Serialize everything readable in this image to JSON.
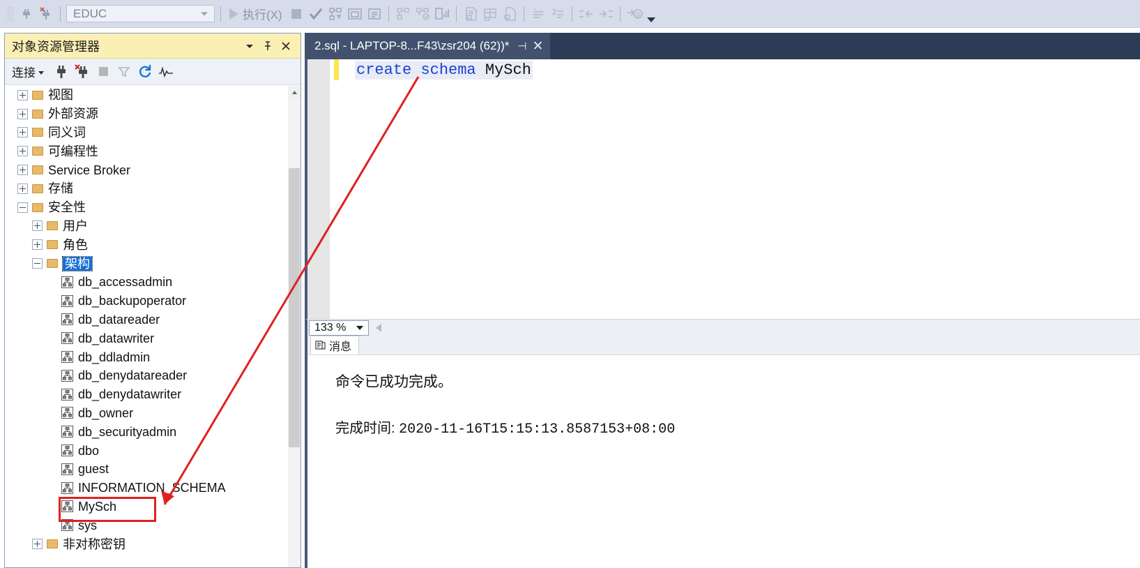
{
  "toolbar": {
    "database_combo": {
      "value": "EDUC",
      "name": "database-selector"
    },
    "execute_label": "执行(X)",
    "icons": [
      "connect-icon",
      "disconnect-icon",
      "stop-icon",
      "parse-check-icon",
      "display-estimated-plan-icon",
      "query-options-icon",
      "include-actual-plan-icon",
      "include-client-statistics-icon",
      "results-to-text-icon",
      "results-to-grid-icon",
      "results-to-file-icon",
      "comment-icon",
      "uncomment-icon",
      "decrease-indent-icon",
      "increase-indent-icon",
      "specify-values-icon"
    ]
  },
  "object_explorer": {
    "title": "对象资源管理器",
    "title_buttons": [
      "window-position-icon",
      "pin-icon",
      "close-icon"
    ],
    "connect_label": "连接",
    "toolbar_icons": [
      "connect-plug-icon",
      "disconnect-plug-icon",
      "stop-icon",
      "filter-icon",
      "refresh-icon",
      "activity-monitor-icon"
    ],
    "tree": [
      {
        "label": "视图",
        "indent": 0,
        "expander": "plus",
        "icon": "folder",
        "selected": false
      },
      {
        "label": "外部资源",
        "indent": 0,
        "expander": "plus",
        "icon": "folder",
        "selected": false
      },
      {
        "label": "同义词",
        "indent": 0,
        "expander": "plus",
        "icon": "folder",
        "selected": false
      },
      {
        "label": "可编程性",
        "indent": 0,
        "expander": "plus",
        "icon": "folder",
        "selected": false
      },
      {
        "label": "Service Broker",
        "indent": 0,
        "expander": "plus",
        "icon": "folder",
        "selected": false
      },
      {
        "label": "存储",
        "indent": 0,
        "expander": "plus",
        "icon": "folder",
        "selected": false
      },
      {
        "label": "安全性",
        "indent": 0,
        "expander": "minus",
        "icon": "folder",
        "selected": false
      },
      {
        "label": "用户",
        "indent": 1,
        "expander": "plus",
        "icon": "folder",
        "selected": false
      },
      {
        "label": "角色",
        "indent": 1,
        "expander": "plus",
        "icon": "folder",
        "selected": false
      },
      {
        "label": "架构",
        "indent": 1,
        "expander": "minus",
        "icon": "folder",
        "selected": true
      },
      {
        "label": "db_accessadmin",
        "indent": 2,
        "expander": "none",
        "icon": "schema",
        "selected": false
      },
      {
        "label": "db_backupoperator",
        "indent": 2,
        "expander": "none",
        "icon": "schema",
        "selected": false
      },
      {
        "label": "db_datareader",
        "indent": 2,
        "expander": "none",
        "icon": "schema",
        "selected": false
      },
      {
        "label": "db_datawriter",
        "indent": 2,
        "expander": "none",
        "icon": "schema",
        "selected": false
      },
      {
        "label": "db_ddladmin",
        "indent": 2,
        "expander": "none",
        "icon": "schema",
        "selected": false
      },
      {
        "label": "db_denydatareader",
        "indent": 2,
        "expander": "none",
        "icon": "schema",
        "selected": false
      },
      {
        "label": "db_denydatawriter",
        "indent": 2,
        "expander": "none",
        "icon": "schema",
        "selected": false
      },
      {
        "label": "db_owner",
        "indent": 2,
        "expander": "none",
        "icon": "schema",
        "selected": false
      },
      {
        "label": "db_securityadmin",
        "indent": 2,
        "expander": "none",
        "icon": "schema",
        "selected": false
      },
      {
        "label": "dbo",
        "indent": 2,
        "expander": "none",
        "icon": "schema",
        "selected": false
      },
      {
        "label": "guest",
        "indent": 2,
        "expander": "none",
        "icon": "schema",
        "selected": false
      },
      {
        "label": "INFORMATION_SCHEMA",
        "indent": 2,
        "expander": "none",
        "icon": "schema",
        "selected": false
      },
      {
        "label": "MySch",
        "indent": 2,
        "expander": "none",
        "icon": "schema",
        "selected": false
      },
      {
        "label": "sys",
        "indent": 2,
        "expander": "none",
        "icon": "schema",
        "selected": false
      },
      {
        "label": "非对称密钥",
        "indent": 1,
        "expander": "plus",
        "icon": "folder",
        "selected": false
      }
    ]
  },
  "editor": {
    "tab_title": "2.sql - LAPTOP-8...F43\\zsr204 (62))*",
    "tab_pin_icon": "pin-icon",
    "tab_close_icon": "close-icon",
    "code": {
      "keyword1": "create",
      "keyword2": "schema",
      "identifier": "MySch"
    },
    "zoom_level": "133 %"
  },
  "results": {
    "tab_label": "消息",
    "tab_icon": "messages-icon",
    "message_line1": "命令已成功完成。",
    "completion_label": "完成时间: ",
    "completion_value": "2020-11-16T15:15:13.8587153+08:00"
  },
  "annotations": {
    "highlight_color": "#e02020",
    "box_target": "MySch",
    "arrow": "points from create-schema statement to MySch tree node"
  }
}
